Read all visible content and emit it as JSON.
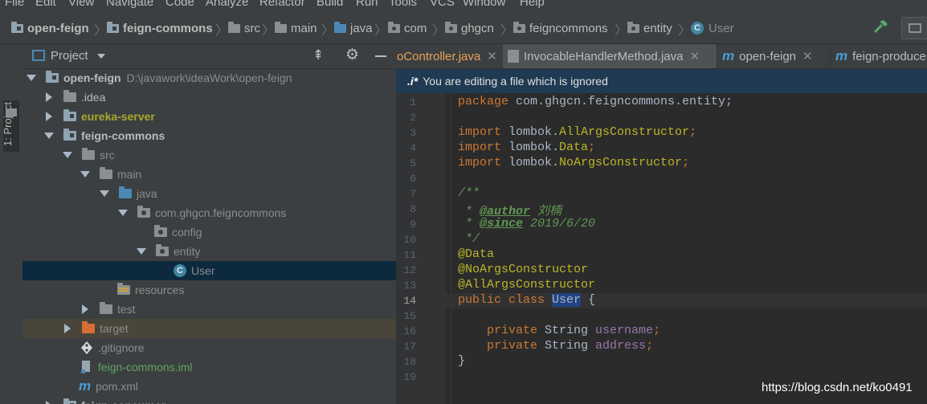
{
  "menu": [
    "File",
    "Edit",
    "View",
    "Navigate",
    "Code",
    "Analyze",
    "Refactor",
    "Build",
    "Run",
    "Tools",
    "VCS",
    "Window",
    "Help"
  ],
  "breadcrumb": {
    "items": [
      "open-feign",
      "feign-commons",
      "src",
      "main",
      "java",
      "com",
      "ghgcn",
      "feigncommons",
      "entity",
      "User"
    ]
  },
  "left_stripe": {
    "label": "1: Project"
  },
  "project_panel": {
    "title": "Project",
    "tree": [
      {
        "label": "open-feign",
        "path": "D:\\javawork\\ideaWork\\open-feign"
      },
      {
        "label": ".idea"
      },
      {
        "label": "eureka-server"
      },
      {
        "label": "feign-commons"
      },
      {
        "label": "src"
      },
      {
        "label": "main"
      },
      {
        "label": "java"
      },
      {
        "label": "com.ghgcn.feigncommons"
      },
      {
        "label": "config"
      },
      {
        "label": "entity"
      },
      {
        "label": "User"
      },
      {
        "label": "resources"
      },
      {
        "label": "test"
      },
      {
        "label": "target"
      },
      {
        "label": ".gitignore"
      },
      {
        "label": "feign-commons.iml"
      },
      {
        "label": "pom.xml"
      },
      {
        "label": "feign-consumer"
      }
    ]
  },
  "tabs": [
    "oController.java",
    "InvocableHandlerMethod.java",
    "open-feign",
    "feign-producer"
  ],
  "banner": {
    "tag": ".i*",
    "text": "You are editing a file which is ignored"
  },
  "editor": {
    "line_numbers": [
      "1",
      "2",
      "3",
      "4",
      "5",
      "6",
      "7",
      "8",
      "9",
      "10",
      "11",
      "12",
      "13",
      "14",
      "15",
      "16",
      "17",
      "18",
      "19"
    ],
    "lines": {
      "l1_kw": "package",
      "l1_rest": " com.ghgcn.feigncommons.entity;",
      "l3_kw": "import",
      "l3_rest": " lombok.",
      "l3_ann": "AllArgsConstructor",
      "l3_end": ";",
      "l4_kw": "import",
      "l4_rest": " lombok.",
      "l4_ann": "Data",
      "l4_end": ";",
      "l5_kw": "import",
      "l5_rest": " lombok.",
      "l5_ann": "NoArgsConstructor",
      "l5_end": ";",
      "l7": "/**",
      "l8_pre": " * ",
      "l8_tag": "@author",
      "l8_val": " 刘楠",
      "l9_pre": " * ",
      "l9_tag": "@since",
      "l9_val": " 2019/6/20",
      "l10": " */",
      "l11": "@Data",
      "l12": "@NoArgsConstructor",
      "l13": "@AllArgsConstructor",
      "l14_kw": "public class",
      "l14_name": "User",
      "l14_end": " {",
      "l16_kw": "    private",
      "l16_type": " String ",
      "l16_field": "username",
      "l16_end": ";",
      "l17_kw": "    private",
      "l17_type": " String ",
      "l17_field": "address",
      "l17_end": ";",
      "l18": "}"
    }
  },
  "watermark": "https://blog.csdn.net/ko0491",
  "colors": {
    "keyword": "#cc7832",
    "annotation": "#bbb529",
    "comment": "#629755",
    "field": "#9876aa",
    "selection": "#0d293e"
  }
}
